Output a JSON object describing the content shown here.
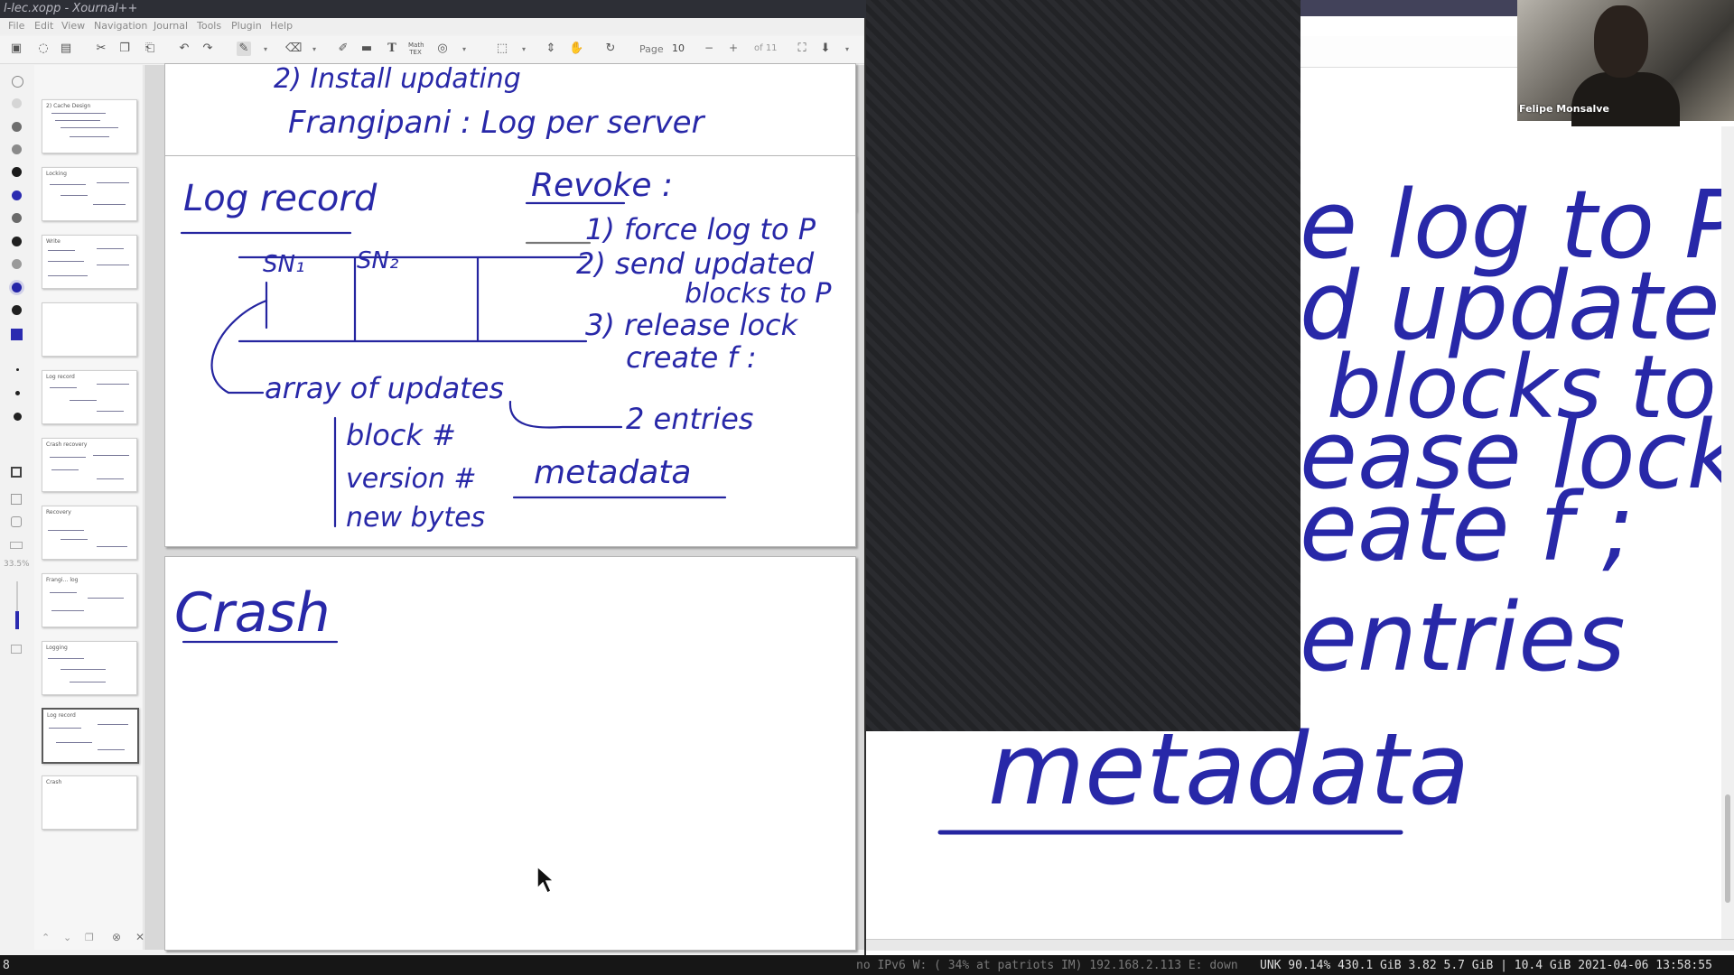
{
  "window": {
    "title": "l-lec.xopp - Xournal++"
  },
  "menu": [
    "File",
    "Edit",
    "View",
    "Navigation",
    "Journal",
    "Tools",
    "Plugin",
    "Help"
  ],
  "toolbar": {
    "page_label": "Page",
    "page_value": "10",
    "page_minus": "−",
    "page_plus": "+",
    "page_of": "of 11"
  },
  "toolbox": {
    "colors": [
      "#ffffff",
      "#d8d8d8",
      "#707070",
      "#8a8a8a",
      "#1c1c1c",
      "#2b2bb0",
      "#6a6a6a",
      "#202020",
      "#9a9a9a",
      "#2323a8",
      "#202020",
      "#2b2bb0"
    ],
    "zoom_text": "33.5%"
  },
  "sidebar": {
    "thumbnails": [
      {
        "label": "2) Cache Design"
      },
      {
        "label": "Locking"
      },
      {
        "label": "Write"
      },
      {
        "label": ""
      },
      {
        "label": "Log record"
      },
      {
        "label": "Crash recovery"
      },
      {
        "label": "Recovery"
      },
      {
        "label": "Frangi… log"
      },
      {
        "label": "Logging"
      },
      {
        "label": "Log record"
      },
      {
        "label": "Crash"
      }
    ],
    "selected_index": 9
  },
  "page_top": {
    "lines": [
      "2) Install updating",
      "Frangipani :  Log per server"
    ]
  },
  "page_main": {
    "log_record": "Log record",
    "sn1": "SN₁",
    "sn2": "SN₂",
    "array_of_updates": "array of updates",
    "block": "block #",
    "version": "version #",
    "newbytes": "new bytes",
    "revoke": "Revoke :",
    "step1": "1) force log to P",
    "step2a": "2) send updated",
    "step2b": "blocks to P",
    "step3a": "3) release lock",
    "step3b": "create f :",
    "entries": "2 entries",
    "metadata": "metadata"
  },
  "page_crash": {
    "title": "Crash"
  },
  "zoom": {
    "line1": "e log to P",
    "line2": "d updated",
    "line3": "blocks to P",
    "line4": "ease lock",
    "line5": "eate f ;",
    "line6": "entries",
    "line7": "metadata"
  },
  "webcam": {
    "name": "Felipe Monsalve"
  },
  "statusbar": {
    "workspace": "8",
    "dim": "no IPv6 W: ( 34% at patriots IM) 192.168.2.113 E: down",
    "bright": "UNK 90.14% 430.1 GiB 3.82 5.7 GiB | 10.4 GiB 2021-04-06 13:58:55"
  }
}
